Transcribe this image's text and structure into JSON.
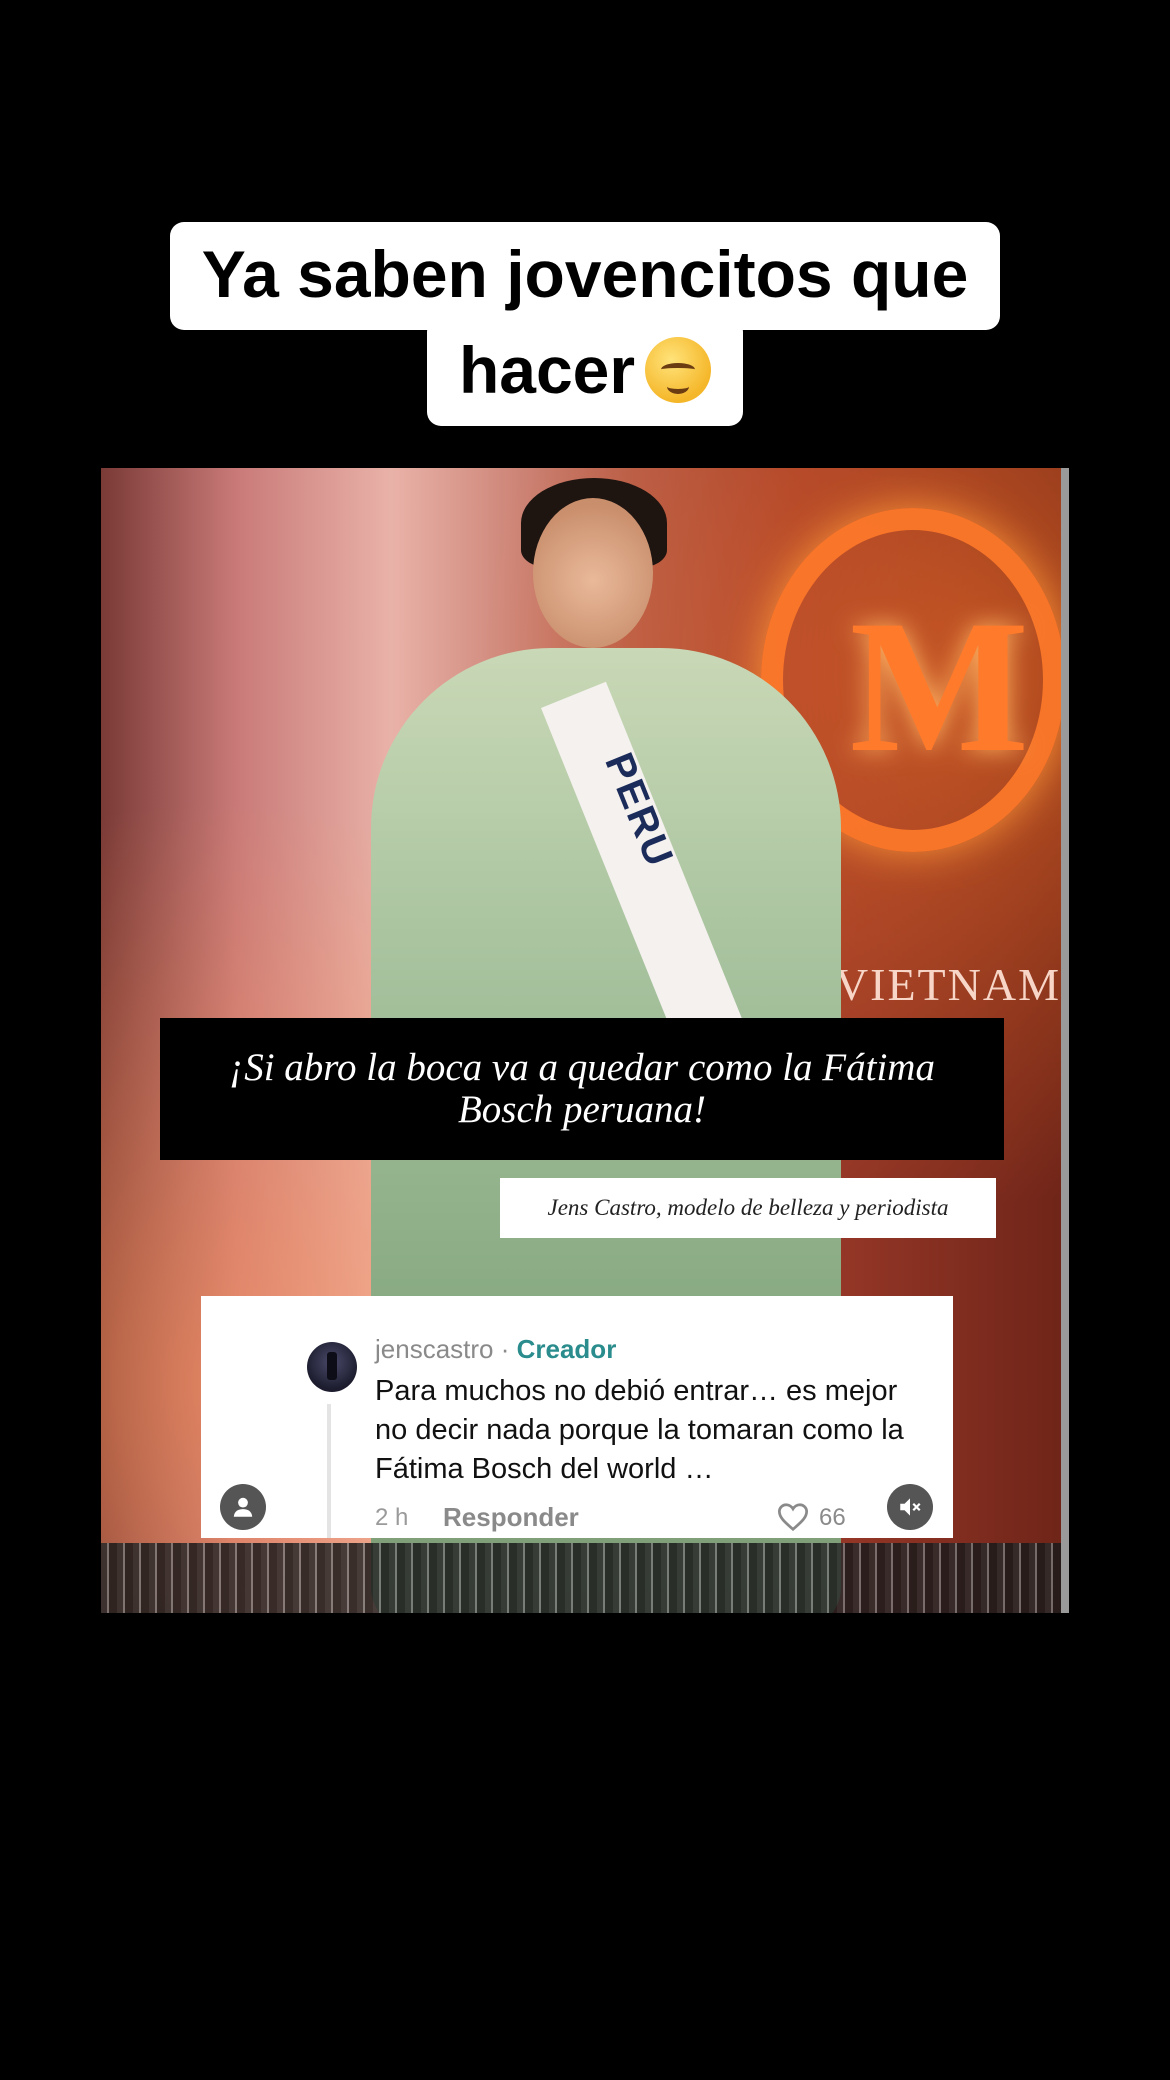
{
  "caption": {
    "line1": "Ya saben jovencitos que",
    "line2": "hacer",
    "emoji_icon": "face-with-steam-from-nose"
  },
  "photo": {
    "sash_text": "PERU",
    "background_text": "VIETNAM"
  },
  "quote": {
    "text": "¡Si abro la boca va a quedar como la Fátima Bosch peruana!",
    "attribution": "Jens Castro, modelo de belleza y periodista"
  },
  "comment": {
    "username": "jenscastro",
    "separator": " · ",
    "creator_label": "Creador",
    "body": "Para muchos no debió entrar… es mejor no decir nada porque la tomaran como la Fátima Bosch del world …",
    "time": "2 h",
    "reply_label": "Responder",
    "likes": "66"
  },
  "controls": {
    "profile_icon": "person-icon",
    "mute_icon": "speaker-muted-icon"
  },
  "colors": {
    "background": "#000000",
    "creator_accent": "#2a8c8c"
  }
}
